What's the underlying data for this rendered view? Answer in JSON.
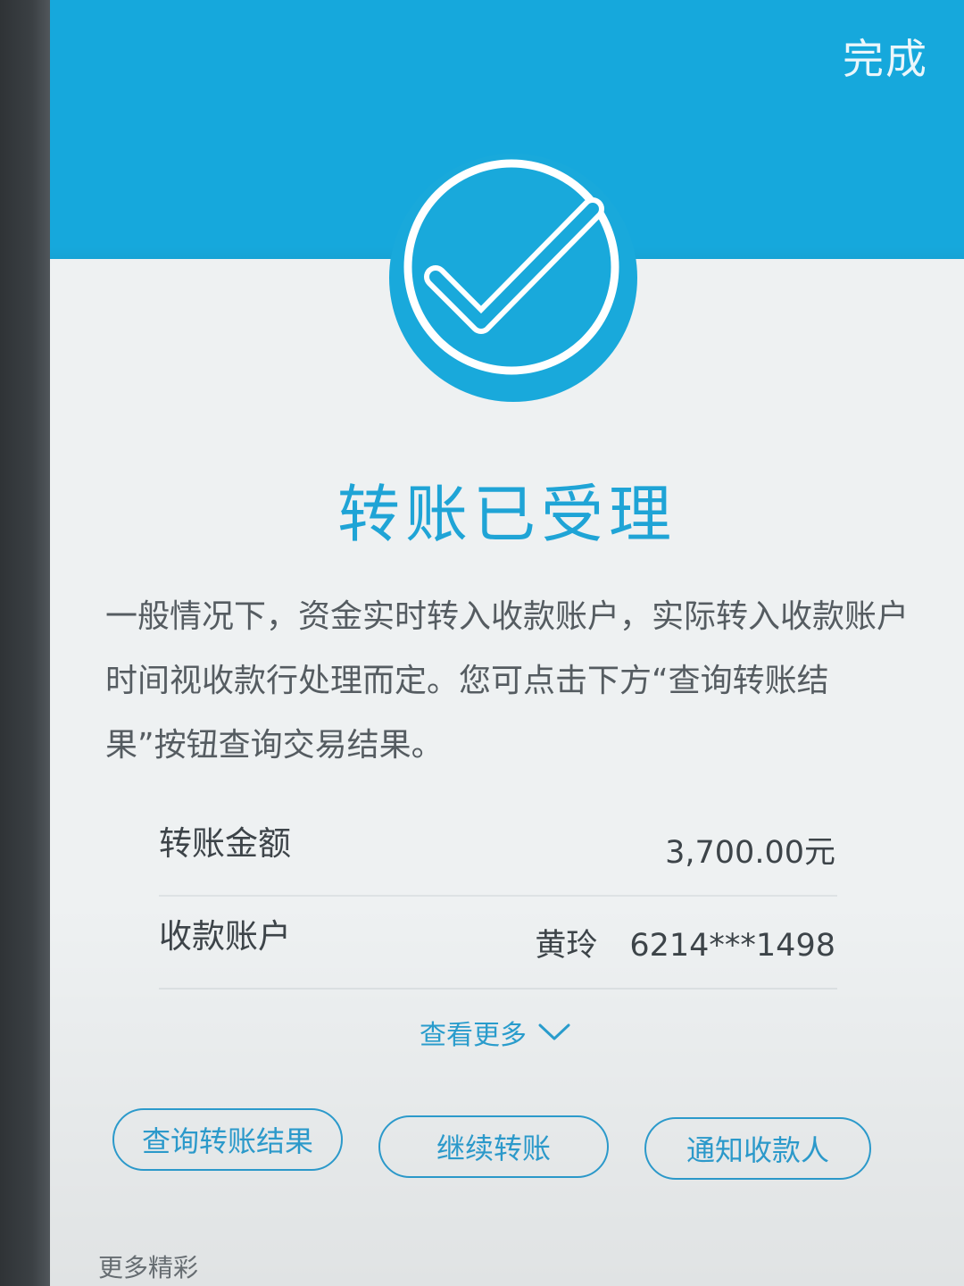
{
  "header": {
    "done_label": "完成"
  },
  "status": {
    "icon": "check-circle-icon",
    "title": "转账已受理"
  },
  "notice": {
    "text": "一般情况下，资金实时转入收款账户，实际转入收款账户时间视收款行处理而定。您可点击下方“查询转账结果”按钮查询交易结果。"
  },
  "details": [
    {
      "label": "转账金额",
      "value": "3,700.00元"
    },
    {
      "label": "收款账户",
      "name": "黄玲",
      "account": "6214***1498"
    }
  ],
  "see_more": {
    "label": "查看更多",
    "icon": "chevron-down-icon"
  },
  "actions": {
    "query_result": "查询转账结果",
    "continue_transfer": "继续转账",
    "notify_payee": "通知收款人"
  },
  "footer": {
    "label": "更多精彩"
  },
  "colors": {
    "brand_blue": "#16a8dc",
    "title_blue": "#1fa4d6",
    "button_blue": "#2d9fd2",
    "background": "#eef1f2"
  }
}
